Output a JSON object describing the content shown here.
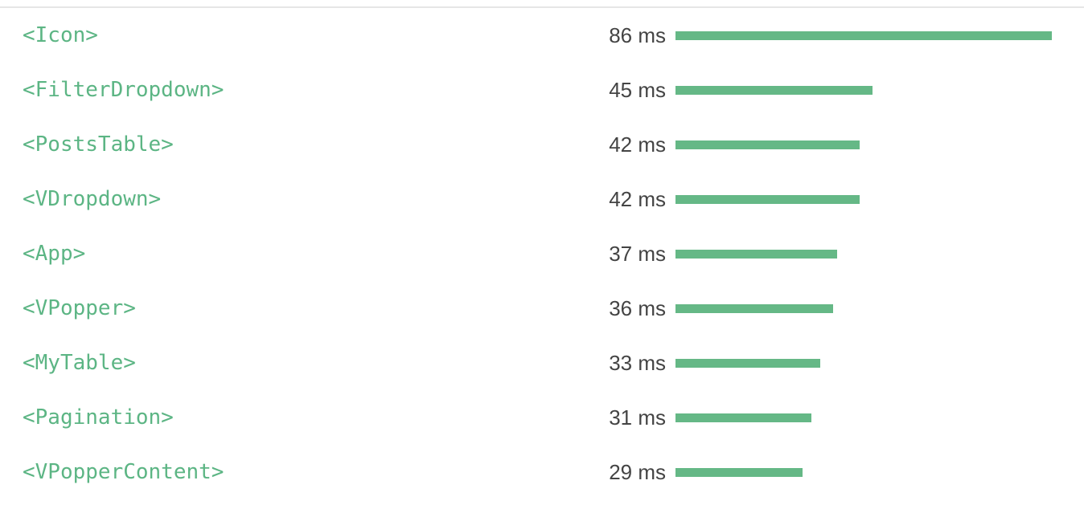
{
  "colors": {
    "name": "#5cb584",
    "bar": "#65b886",
    "time": "#444444",
    "border": "#e6e6e6"
  },
  "rows": [
    {
      "name": "<Icon>",
      "time_label": "86 ms",
      "ms": 86
    },
    {
      "name": "<FilterDropdown>",
      "time_label": "45 ms",
      "ms": 45
    },
    {
      "name": "<PostsTable>",
      "time_label": "42 ms",
      "ms": 42
    },
    {
      "name": "<VDropdown>",
      "time_label": "42 ms",
      "ms": 42
    },
    {
      "name": "<App>",
      "time_label": "37 ms",
      "ms": 37
    },
    {
      "name": "<VPopper>",
      "time_label": "36 ms",
      "ms": 36
    },
    {
      "name": "<MyTable>",
      "time_label": "33 ms",
      "ms": 33
    },
    {
      "name": "<Pagination>",
      "time_label": "31 ms",
      "ms": 31
    },
    {
      "name": "<VPopperContent>",
      "time_label": "29 ms",
      "ms": 29
    }
  ]
}
